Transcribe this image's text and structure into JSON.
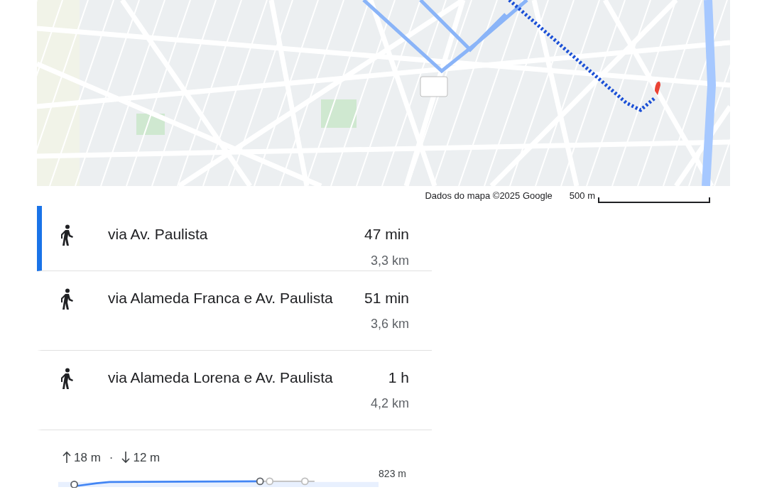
{
  "map": {
    "attribution": "Dados do mapa ©2025 Google",
    "scale_label": "500 m"
  },
  "routes": [
    {
      "summary": "via Av. Paulista",
      "duration": "47 min",
      "distance": "3,3 km",
      "selected": true
    },
    {
      "summary": "via Alameda Franca e Av. Paulista",
      "duration": "51 min",
      "distance": "3,6 km",
      "selected": false
    },
    {
      "summary": "via Alameda Lorena e Av. Paulista",
      "duration": "1 h",
      "distance": "4,2 km",
      "selected": false
    }
  ],
  "elevation": {
    "ascent": "18 m",
    "descent": "12 m",
    "separator": "·",
    "max_label": "823 m"
  }
}
